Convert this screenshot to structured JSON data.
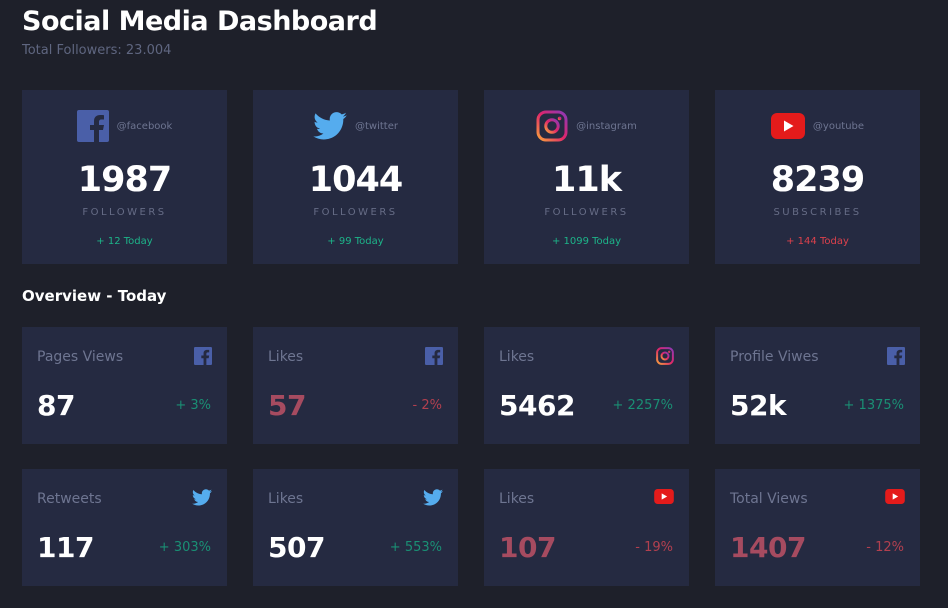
{
  "header": {
    "title": "Social Media Dashboard",
    "subtitle": "Total Followers: 23.004"
  },
  "followers": [
    {
      "platform": "facebook",
      "icon": "facebook-icon",
      "handle": "@facebook",
      "count": "1987",
      "label": "FOLLOWERS",
      "change": "+ 12 Today",
      "trend": "up"
    },
    {
      "platform": "twitter",
      "icon": "twitter-icon",
      "handle": "@twitter",
      "count": "1044",
      "label": "FOLLOWERS",
      "change": "+ 99 Today",
      "trend": "up"
    },
    {
      "platform": "instagram",
      "icon": "instagram-icon",
      "handle": "@instagram",
      "count": "11k",
      "label": "FOLLOWERS",
      "change": "+ 1099 Today",
      "trend": "up"
    },
    {
      "platform": "youtube",
      "icon": "youtube-icon",
      "handle": "@youtube",
      "count": "8239",
      "label": "SUBSCRIBES",
      "change": "+ 144 Today",
      "trend": "down"
    }
  ],
  "overview": {
    "title": "Overview - Today",
    "cards": [
      {
        "label": "Pages Views",
        "icon": "facebook-icon",
        "value": "87",
        "change": "+ 3%",
        "trend": "up"
      },
      {
        "label": "Likes",
        "icon": "facebook-icon",
        "value": "57",
        "change": "- 2%",
        "trend": "down"
      },
      {
        "label": "Likes",
        "icon": "instagram-icon",
        "value": "5462",
        "change": "+ 2257%",
        "trend": "up"
      },
      {
        "label": "Profile Viwes",
        "icon": "facebook-icon",
        "value": "52k",
        "change": "+ 1375%",
        "trend": "up"
      },
      {
        "label": "Retweets",
        "icon": "twitter-icon",
        "value": "117",
        "change": "+ 303%",
        "trend": "up"
      },
      {
        "label": "Likes",
        "icon": "twitter-icon",
        "value": "507",
        "change": "+ 553%",
        "trend": "up"
      },
      {
        "label": "Likes",
        "icon": "youtube-icon",
        "value": "107",
        "change": "- 19%",
        "trend": "down"
      },
      {
        "label": "Total Views",
        "icon": "youtube-icon",
        "value": "1407",
        "change": "- 12%",
        "trend": "down"
      }
    ]
  },
  "colors": {
    "background": "#1e202a",
    "card": "#252a41",
    "positive": "#1db489",
    "negative": "#dc414c",
    "facebook": "#4b6cb7",
    "twitter": "#55acee",
    "youtube": "#e41b1b"
  }
}
